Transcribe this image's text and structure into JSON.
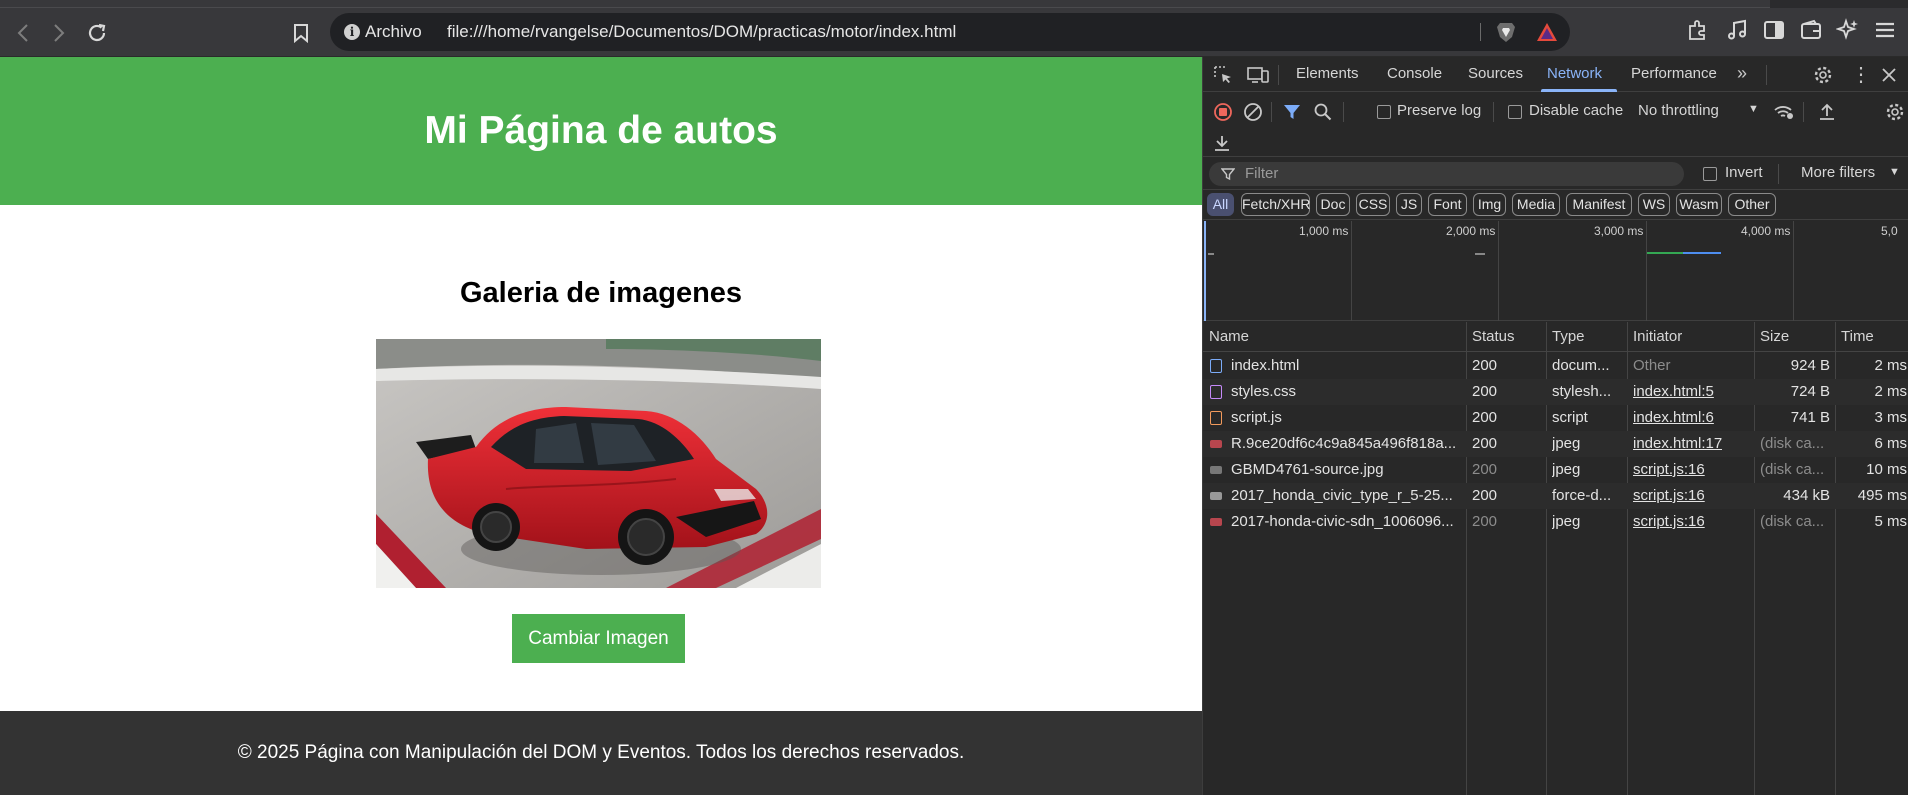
{
  "browser": {
    "url_scheme_label": "Archivo",
    "url": "file:///home/rvangelse/Documentos/DOM/practicas/motor/index.html"
  },
  "page": {
    "header_title": "Mi Página de autos",
    "gallery_title": "Galeria de imagenes",
    "image_alt": "red Honda Civic Type R",
    "button_label": "Cambiar Imagen",
    "footer_text": "© 2025 Página con Manipulación del DOM y Eventos. Todos los derechos reservados.",
    "colors": {
      "header_bg": "#4caf50",
      "footer_bg": "#333333",
      "button_bg": "#4caf50",
      "car_red": "#d91d26"
    }
  },
  "devtools": {
    "tabs": [
      "Elements",
      "Console",
      "Sources",
      "Network",
      "Performance"
    ],
    "active_tab": "Network",
    "toolbar": {
      "preserve_log": "Preserve log",
      "disable_cache": "Disable cache",
      "throttling": "No throttling"
    },
    "filter": {
      "placeholder": "Filter",
      "invert": "Invert",
      "more_filters": "More filters"
    },
    "type_filters": [
      "All",
      "Fetch/XHR",
      "Doc",
      "CSS",
      "JS",
      "Font",
      "Img",
      "Media",
      "Manifest",
      "WS",
      "Wasm",
      "Other"
    ],
    "timeline_labels": [
      "1,000 ms",
      "2,000 ms",
      "3,000 ms",
      "4,000 ms",
      "5,0"
    ],
    "columns": [
      "Name",
      "Status",
      "Type",
      "Initiator",
      "Size",
      "Time"
    ],
    "rows": [
      {
        "name": "index.html",
        "status": "200",
        "type": "docum...",
        "initiator": "Other",
        "size": "924 B",
        "time": "2 ms",
        "icon": "document-icon"
      },
      {
        "name": "styles.css",
        "status": "200",
        "type": "stylesh...",
        "initiator": "index.html:5",
        "size": "724 B",
        "time": "2 ms",
        "icon": "stylesheet-icon"
      },
      {
        "name": "script.js",
        "status": "200",
        "type": "script",
        "initiator": "index.html:6",
        "size": "741 B",
        "time": "3 ms",
        "icon": "script-icon"
      },
      {
        "name": "R.9ce20df6c4c9a845a496f818a...",
        "status": "200",
        "type": "jpeg",
        "initiator": "index.html:17",
        "size": "(disk ca...",
        "time": "6 ms",
        "icon": "image-icon"
      },
      {
        "name": "GBMD4761-source.jpg",
        "status": "200",
        "type": "jpeg",
        "initiator": "script.js:16",
        "size": "(disk ca...",
        "time": "10 ms",
        "icon": "image-icon"
      },
      {
        "name": "2017_honda_civic_type_r_5-25...",
        "status": "200",
        "type": "force-d...",
        "initiator": "script.js:16",
        "size": "434 kB",
        "time": "495 ms",
        "icon": "image-icon"
      },
      {
        "name": "2017-honda-civic-sdn_1006096...",
        "status": "200",
        "type": "jpeg",
        "initiator": "script.js:16",
        "size": "(disk ca...",
        "time": "5 ms",
        "icon": "image-icon"
      }
    ]
  }
}
